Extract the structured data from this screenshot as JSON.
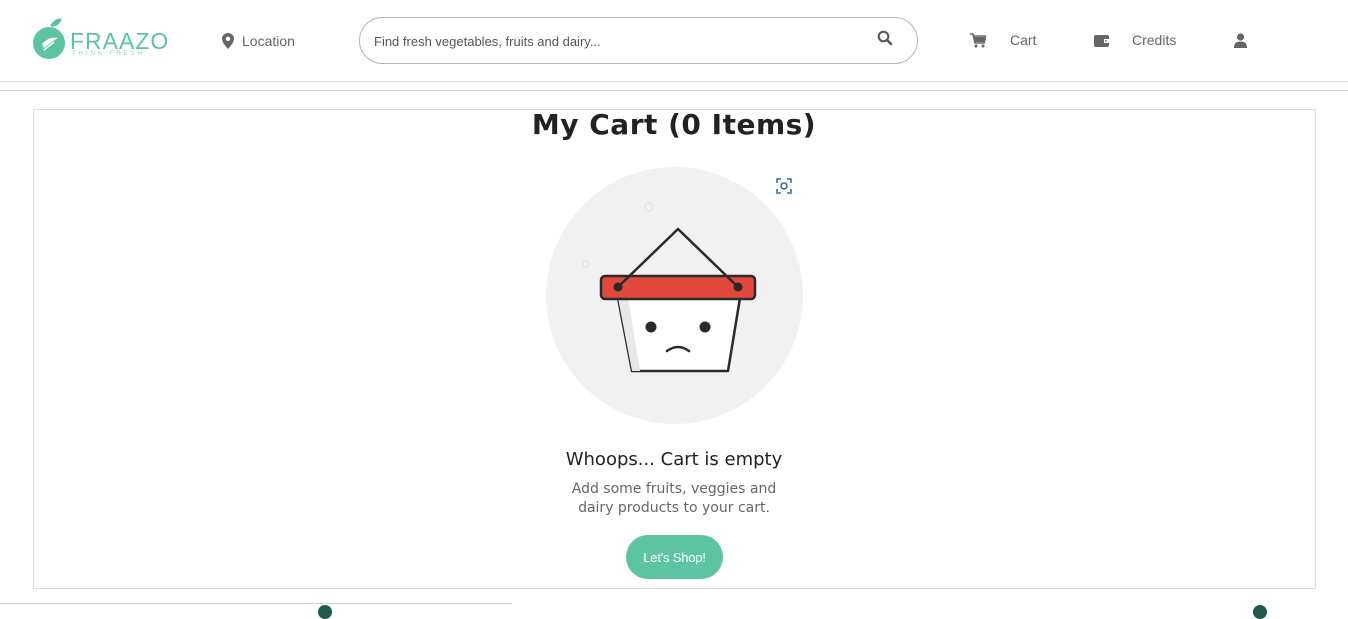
{
  "header": {
    "logo": {
      "wordmark": "FRAAZO",
      "tagline": "THINK FRESH",
      "color": "#5cc3a3"
    },
    "location_label": "Location",
    "search": {
      "placeholder": "Find fresh vegetables, fruits and dairy..."
    },
    "nav": {
      "cart_label": "Cart",
      "credits_label": "Credits"
    }
  },
  "main": {
    "title": "My Cart (0 Items)",
    "empty_title": "Whoops... Cart is empty",
    "empty_subtitle": "Add some fruits, veggies and dairy products to your cart.",
    "shop_button": "Let's Shop!"
  },
  "colors": {
    "accent": "#5cc3a3",
    "basket_red": "#e2483b"
  },
  "icons": [
    "location-pin-icon",
    "search-icon",
    "cart-icon",
    "wallet-icon",
    "user-icon",
    "scan-icon",
    "empty-basket-illustration"
  ]
}
